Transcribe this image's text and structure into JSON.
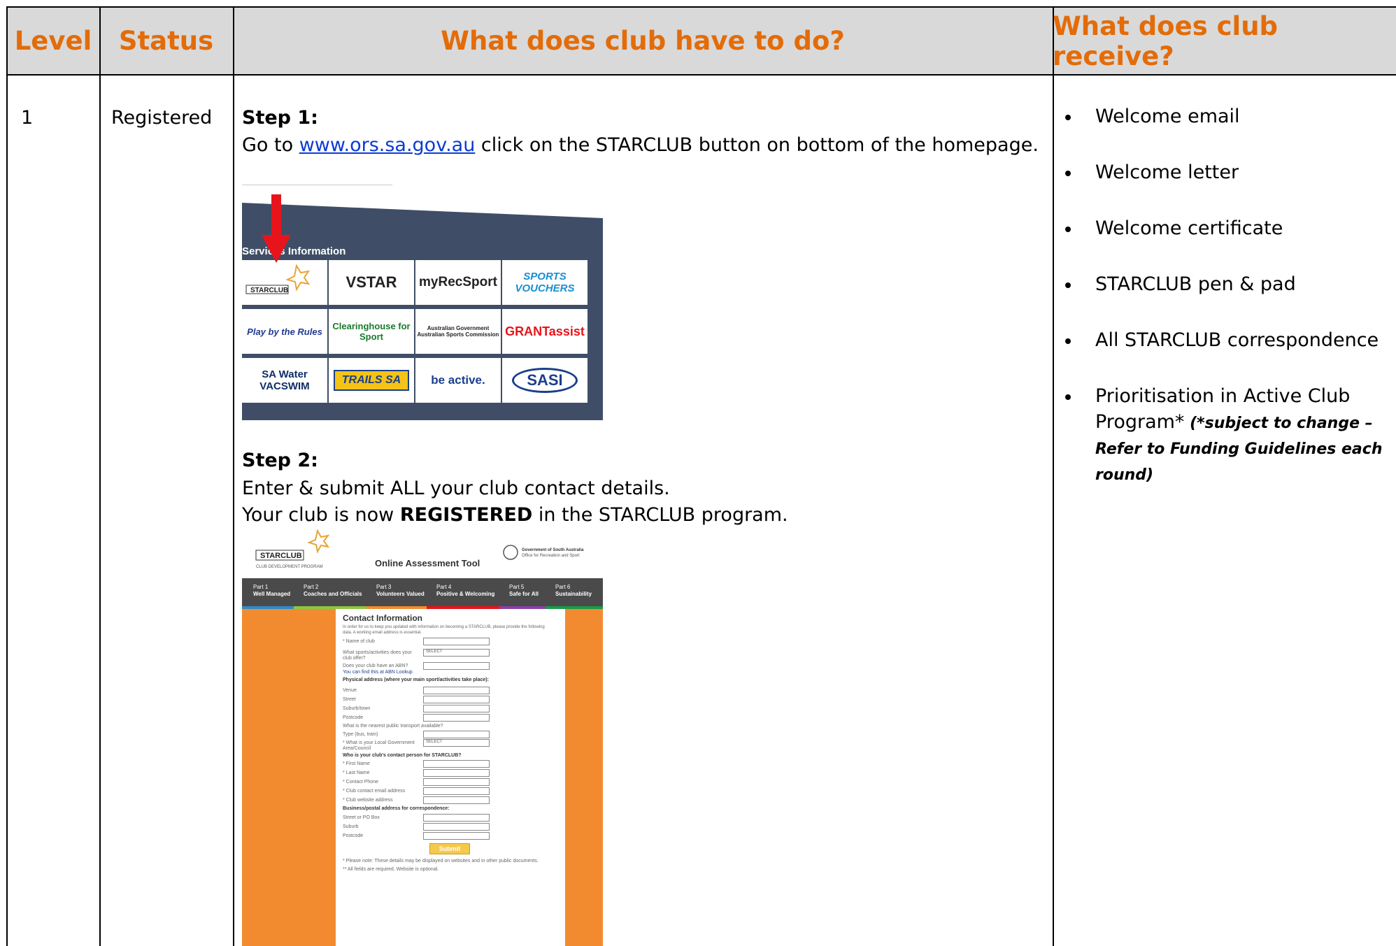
{
  "header": {
    "level": "Level",
    "status": "Status",
    "todo": "What does club have to do?",
    "receive": "What does club receive?"
  },
  "row": {
    "level": "1",
    "status": "Registered",
    "step1_title": "Step 1:",
    "step1_prefix": "Go to ",
    "step1_link": "www.ors.sa.gov.au",
    "step1_suffix": " click on the STARCLUB button on bottom of the homepage.",
    "step2_title": "Step 2:",
    "step2_line1": "Enter & submit ALL your club contact details.",
    "step2_line2_prefix": "Your club is now ",
    "step2_line2_bold": "REGISTERED",
    "step2_line2_suffix": " in the STARCLUB program."
  },
  "receives": [
    "Welcome email",
    "Welcome letter",
    "Welcome certificate",
    "STARCLUB pen & pad",
    "All STARCLUB correspondence"
  ],
  "receive_last": {
    "text": "Prioritisation in Active Club Program*",
    "note": " (*subject to change – Refer to Funding Guidelines each round)"
  },
  "screenshot1": {
    "section_title": "Services   Information",
    "tiles": [
      "STARCLUB",
      "VSTAR",
      "myRecSport",
      "SPORTS VOUCHERS",
      "Play by the Rules",
      "Clearinghouse for Sport",
      "Australian Government Australian Sports Commission",
      "GRANTassist",
      "SA Water VACSWIM",
      "TRAILS SA",
      "be active.",
      "SASI"
    ]
  },
  "screenshot2": {
    "logo": "STARCLUB",
    "logo_sub": "CLUB DEVELOPMENT PROGRAM",
    "tool_title": "Online Assessment Tool",
    "gov": "Government of South Australia",
    "gov_sub": "Office for Recreation and Sport",
    "nav": [
      {
        "part": "Part 1",
        "name": "Well Managed"
      },
      {
        "part": "Part 2",
        "name": "Coaches and Officials"
      },
      {
        "part": "Part 3",
        "name": "Volunteers Valued"
      },
      {
        "part": "Part 4",
        "name": "Positive & Welcoming"
      },
      {
        "part": "Part 5",
        "name": "Safe for All"
      },
      {
        "part": "Part 6",
        "name": "Sustainability"
      }
    ],
    "form_title": "Contact Information",
    "intro": "In order for us to keep you updated with information on becoming a STARCLUB, please provide the following data. A working email address is essential.",
    "fields1": [
      "* Name of club",
      "What sports/activities does your club offer?",
      "Does your club have an ABN?"
    ],
    "abn_note": "You can find this at ABN Lookup",
    "physical": "Physical address (where your main sport/activities take place):",
    "fields2": [
      "Venue",
      "Street",
      "Suburb/town",
      "Postcode"
    ],
    "transport": "What is the nearest public transport available?",
    "fields3": [
      "Type (bus, train)",
      "* What is your Local Government Area/Council"
    ],
    "contact_head": "Who is your club's contact person for STARCLUB?",
    "fields4": [
      "* First Name",
      "* Last Name",
      "* Contact Phone",
      "* Club contact email address",
      "* Club website address"
    ],
    "postal": "Business/postal address for correspondence:",
    "fields5": [
      "Street or PO Box",
      "Suburb",
      "Postcode"
    ],
    "select": "SELECT",
    "submit": "Submit",
    "note1": "* Please note: These details may be displayed on websites and in other public documents.",
    "note2": "** All fields are required. Website is optional."
  }
}
